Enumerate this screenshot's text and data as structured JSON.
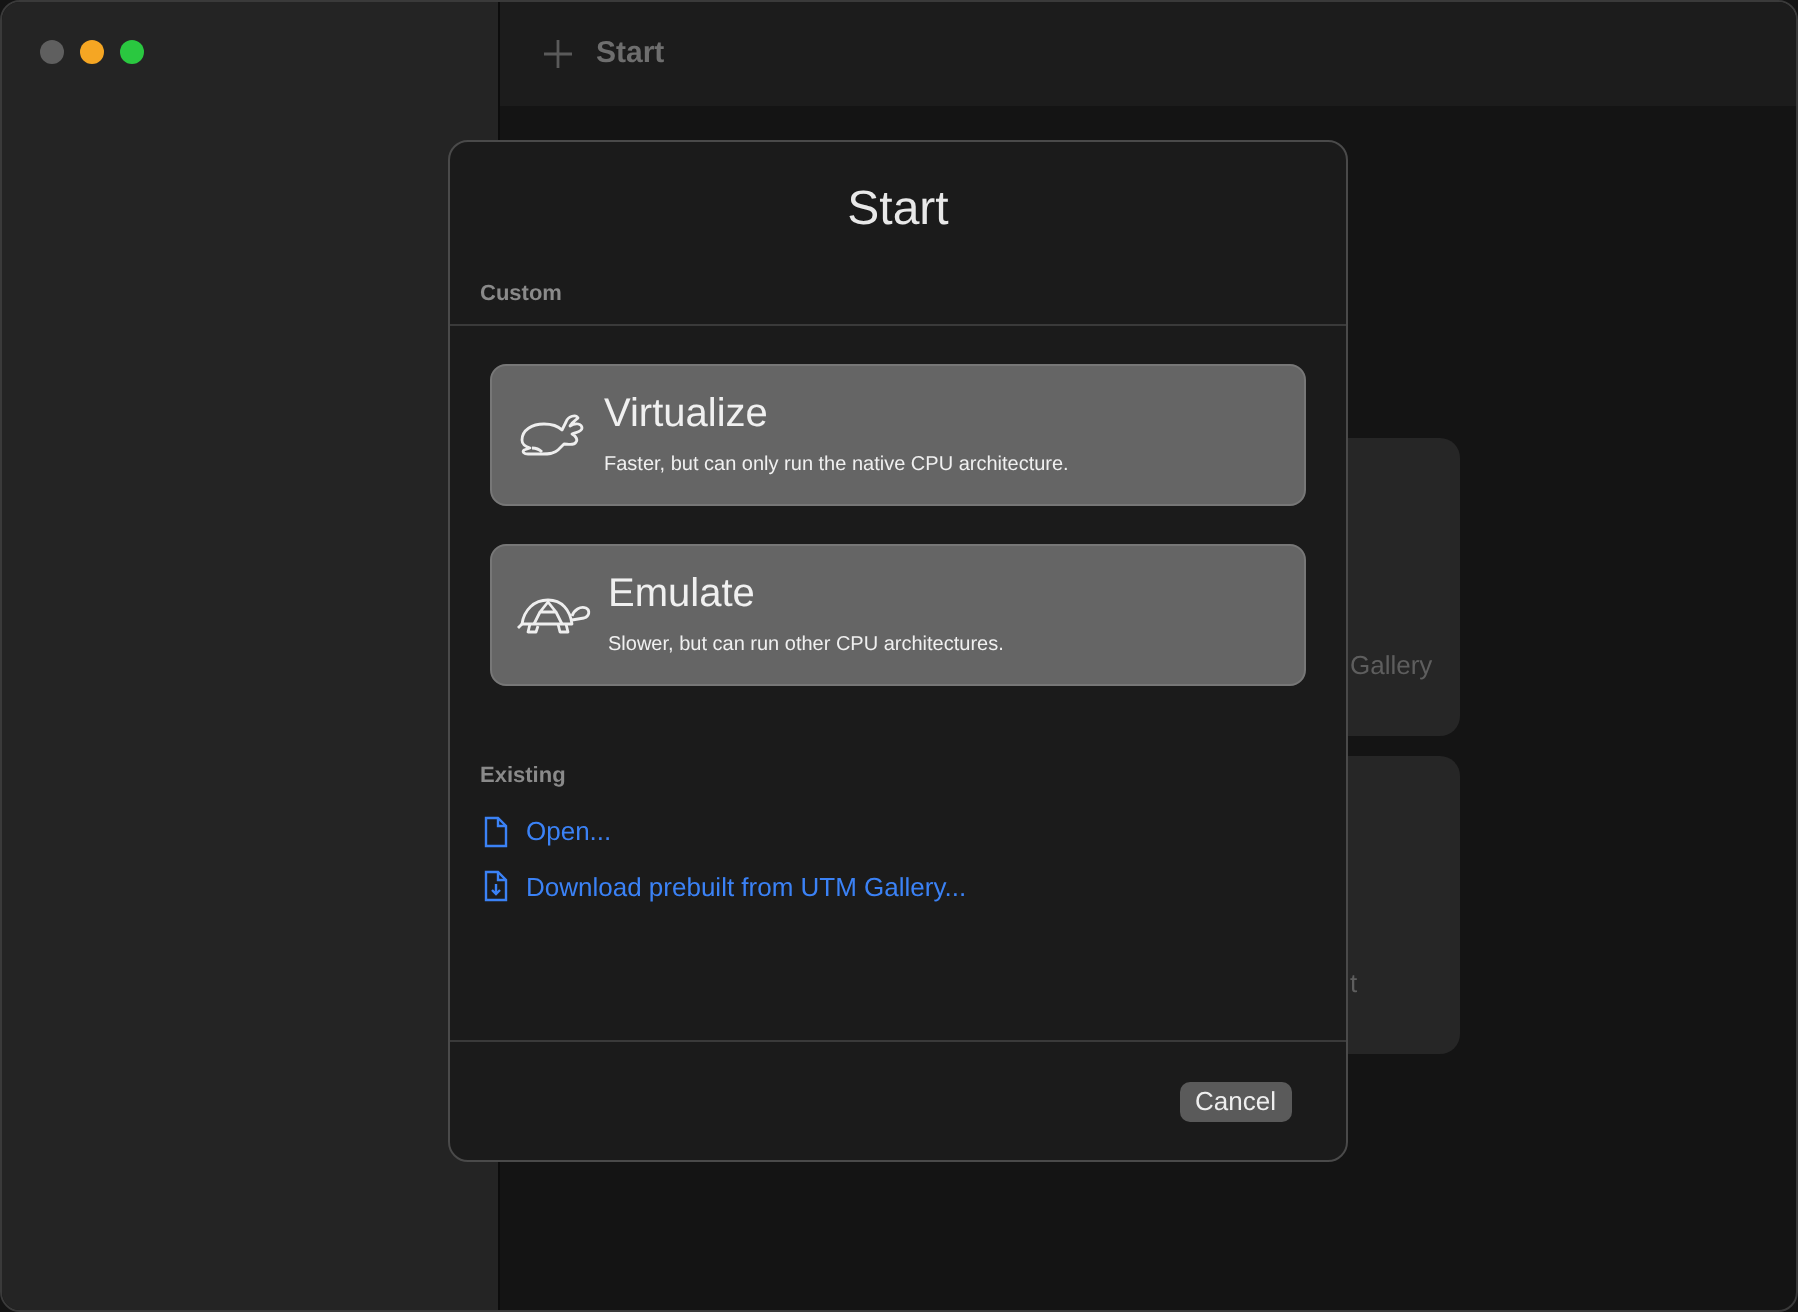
{
  "toolbar": {
    "title": "Start"
  },
  "background_cards": [
    {
      "text": "Gallery"
    },
    {
      "text": "t"
    }
  ],
  "dialog": {
    "title": "Start",
    "custom_label": "Custom",
    "options": [
      {
        "kind": "rabbit",
        "title": "Virtualize",
        "description": "Faster, but can only run the native CPU architecture."
      },
      {
        "kind": "turtle",
        "title": "Emulate",
        "description": "Slower, but can run other CPU architectures."
      }
    ],
    "existing_label": "Existing",
    "links": [
      {
        "kind": "file",
        "label": "Open..."
      },
      {
        "kind": "download",
        "label": "Download prebuilt from UTM Gallery..."
      }
    ],
    "buttons": [
      "Cancel"
    ]
  }
}
